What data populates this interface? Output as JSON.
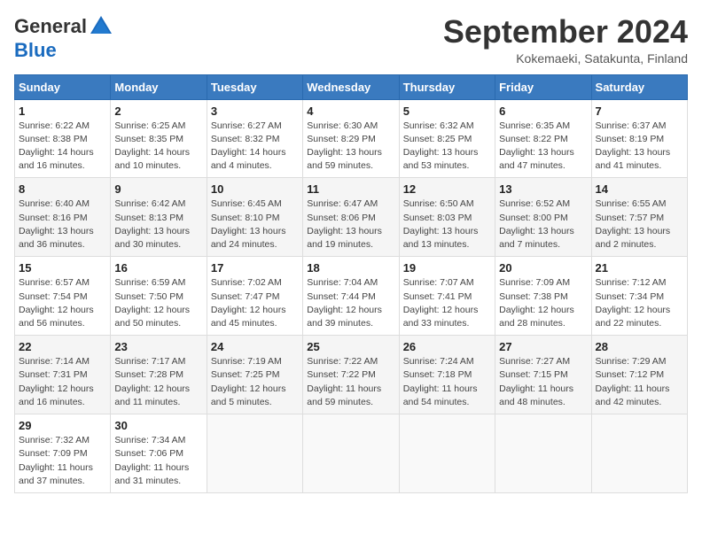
{
  "header": {
    "logo_general": "General",
    "logo_blue": "Blue",
    "month_title": "September 2024",
    "location": "Kokemaeki, Satakunta, Finland"
  },
  "days_of_week": [
    "Sunday",
    "Monday",
    "Tuesday",
    "Wednesday",
    "Thursday",
    "Friday",
    "Saturday"
  ],
  "weeks": [
    [
      {
        "day": "1",
        "info": "Sunrise: 6:22 AM\nSunset: 8:38 PM\nDaylight: 14 hours\nand 16 minutes."
      },
      {
        "day": "2",
        "info": "Sunrise: 6:25 AM\nSunset: 8:35 PM\nDaylight: 14 hours\nand 10 minutes."
      },
      {
        "day": "3",
        "info": "Sunrise: 6:27 AM\nSunset: 8:32 PM\nDaylight: 14 hours\nand 4 minutes."
      },
      {
        "day": "4",
        "info": "Sunrise: 6:30 AM\nSunset: 8:29 PM\nDaylight: 13 hours\nand 59 minutes."
      },
      {
        "day": "5",
        "info": "Sunrise: 6:32 AM\nSunset: 8:25 PM\nDaylight: 13 hours\nand 53 minutes."
      },
      {
        "day": "6",
        "info": "Sunrise: 6:35 AM\nSunset: 8:22 PM\nDaylight: 13 hours\nand 47 minutes."
      },
      {
        "day": "7",
        "info": "Sunrise: 6:37 AM\nSunset: 8:19 PM\nDaylight: 13 hours\nand 41 minutes."
      }
    ],
    [
      {
        "day": "8",
        "info": "Sunrise: 6:40 AM\nSunset: 8:16 PM\nDaylight: 13 hours\nand 36 minutes."
      },
      {
        "day": "9",
        "info": "Sunrise: 6:42 AM\nSunset: 8:13 PM\nDaylight: 13 hours\nand 30 minutes."
      },
      {
        "day": "10",
        "info": "Sunrise: 6:45 AM\nSunset: 8:10 PM\nDaylight: 13 hours\nand 24 minutes."
      },
      {
        "day": "11",
        "info": "Sunrise: 6:47 AM\nSunset: 8:06 PM\nDaylight: 13 hours\nand 19 minutes."
      },
      {
        "day": "12",
        "info": "Sunrise: 6:50 AM\nSunset: 8:03 PM\nDaylight: 13 hours\nand 13 minutes."
      },
      {
        "day": "13",
        "info": "Sunrise: 6:52 AM\nSunset: 8:00 PM\nDaylight: 13 hours\nand 7 minutes."
      },
      {
        "day": "14",
        "info": "Sunrise: 6:55 AM\nSunset: 7:57 PM\nDaylight: 13 hours\nand 2 minutes."
      }
    ],
    [
      {
        "day": "15",
        "info": "Sunrise: 6:57 AM\nSunset: 7:54 PM\nDaylight: 12 hours\nand 56 minutes."
      },
      {
        "day": "16",
        "info": "Sunrise: 6:59 AM\nSunset: 7:50 PM\nDaylight: 12 hours\nand 50 minutes."
      },
      {
        "day": "17",
        "info": "Sunrise: 7:02 AM\nSunset: 7:47 PM\nDaylight: 12 hours\nand 45 minutes."
      },
      {
        "day": "18",
        "info": "Sunrise: 7:04 AM\nSunset: 7:44 PM\nDaylight: 12 hours\nand 39 minutes."
      },
      {
        "day": "19",
        "info": "Sunrise: 7:07 AM\nSunset: 7:41 PM\nDaylight: 12 hours\nand 33 minutes."
      },
      {
        "day": "20",
        "info": "Sunrise: 7:09 AM\nSunset: 7:38 PM\nDaylight: 12 hours\nand 28 minutes."
      },
      {
        "day": "21",
        "info": "Sunrise: 7:12 AM\nSunset: 7:34 PM\nDaylight: 12 hours\nand 22 minutes."
      }
    ],
    [
      {
        "day": "22",
        "info": "Sunrise: 7:14 AM\nSunset: 7:31 PM\nDaylight: 12 hours\nand 16 minutes."
      },
      {
        "day": "23",
        "info": "Sunrise: 7:17 AM\nSunset: 7:28 PM\nDaylight: 12 hours\nand 11 minutes."
      },
      {
        "day": "24",
        "info": "Sunrise: 7:19 AM\nSunset: 7:25 PM\nDaylight: 12 hours\nand 5 minutes."
      },
      {
        "day": "25",
        "info": "Sunrise: 7:22 AM\nSunset: 7:22 PM\nDaylight: 11 hours\nand 59 minutes."
      },
      {
        "day": "26",
        "info": "Sunrise: 7:24 AM\nSunset: 7:18 PM\nDaylight: 11 hours\nand 54 minutes."
      },
      {
        "day": "27",
        "info": "Sunrise: 7:27 AM\nSunset: 7:15 PM\nDaylight: 11 hours\nand 48 minutes."
      },
      {
        "day": "28",
        "info": "Sunrise: 7:29 AM\nSunset: 7:12 PM\nDaylight: 11 hours\nand 42 minutes."
      }
    ],
    [
      {
        "day": "29",
        "info": "Sunrise: 7:32 AM\nSunset: 7:09 PM\nDaylight: 11 hours\nand 37 minutes."
      },
      {
        "day": "30",
        "info": "Sunrise: 7:34 AM\nSunset: 7:06 PM\nDaylight: 11 hours\nand 31 minutes."
      },
      {
        "day": "",
        "info": ""
      },
      {
        "day": "",
        "info": ""
      },
      {
        "day": "",
        "info": ""
      },
      {
        "day": "",
        "info": ""
      },
      {
        "day": "",
        "info": ""
      }
    ]
  ]
}
